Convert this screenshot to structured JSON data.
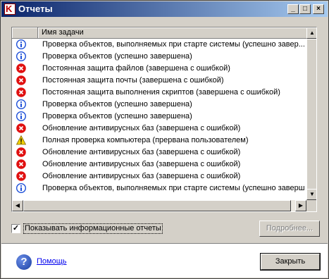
{
  "window": {
    "title": "Отчеты"
  },
  "titlebar": {
    "minimize": "_",
    "maximize": "□",
    "close": "×"
  },
  "list": {
    "header": {
      "column_icon": "",
      "column_name": "Имя задачи"
    },
    "rows": [
      {
        "icon": "info-icon",
        "text": "Проверка объектов, выполняемых при старте системы (успешно завер..."
      },
      {
        "icon": "info-icon",
        "text": "Проверка объектов (успешно завершена)"
      },
      {
        "icon": "error-icon",
        "text": "Постоянная защита файлов (завершена с ошибкой)"
      },
      {
        "icon": "error-icon",
        "text": "Постоянная защита почты (завершена с ошибкой)"
      },
      {
        "icon": "error-icon",
        "text": "Постоянная защита выполнения скриптов (завершена с ошибкой)"
      },
      {
        "icon": "info-icon",
        "text": "Проверка объектов (успешно завершена)"
      },
      {
        "icon": "info-icon",
        "text": "Проверка объектов (успешно завершена)"
      },
      {
        "icon": "error-icon",
        "text": "Обновление антивирусных баз (завершена с ошибкой)"
      },
      {
        "icon": "warning-icon",
        "text": "Полная проверка компьютера (прервана пользователем)"
      },
      {
        "icon": "error-icon",
        "text": "Обновление антивирусных баз (завершена с ошибкой)"
      },
      {
        "icon": "error-icon",
        "text": "Обновление антивирусных баз (завершена с ошибкой)"
      },
      {
        "icon": "error-icon",
        "text": "Обновление антивирусных баз (завершена с ошибкой)"
      },
      {
        "icon": "info-icon",
        "text": "Проверка объектов, выполняемых при старте системы (успешно заверш..."
      }
    ]
  },
  "options": {
    "show_info_reports_label": "Показывать информационные отчеты",
    "show_info_reports_checked": true
  },
  "buttons": {
    "details": "Подробнее...",
    "close": "Закрыть"
  },
  "footer": {
    "help_link": "Помощь"
  },
  "colors": {
    "info": "#1c4fd8",
    "error": "#e01010",
    "warning": "#f0d000",
    "titlebar_start": "#0a246a",
    "titlebar_end": "#a6caf0"
  }
}
